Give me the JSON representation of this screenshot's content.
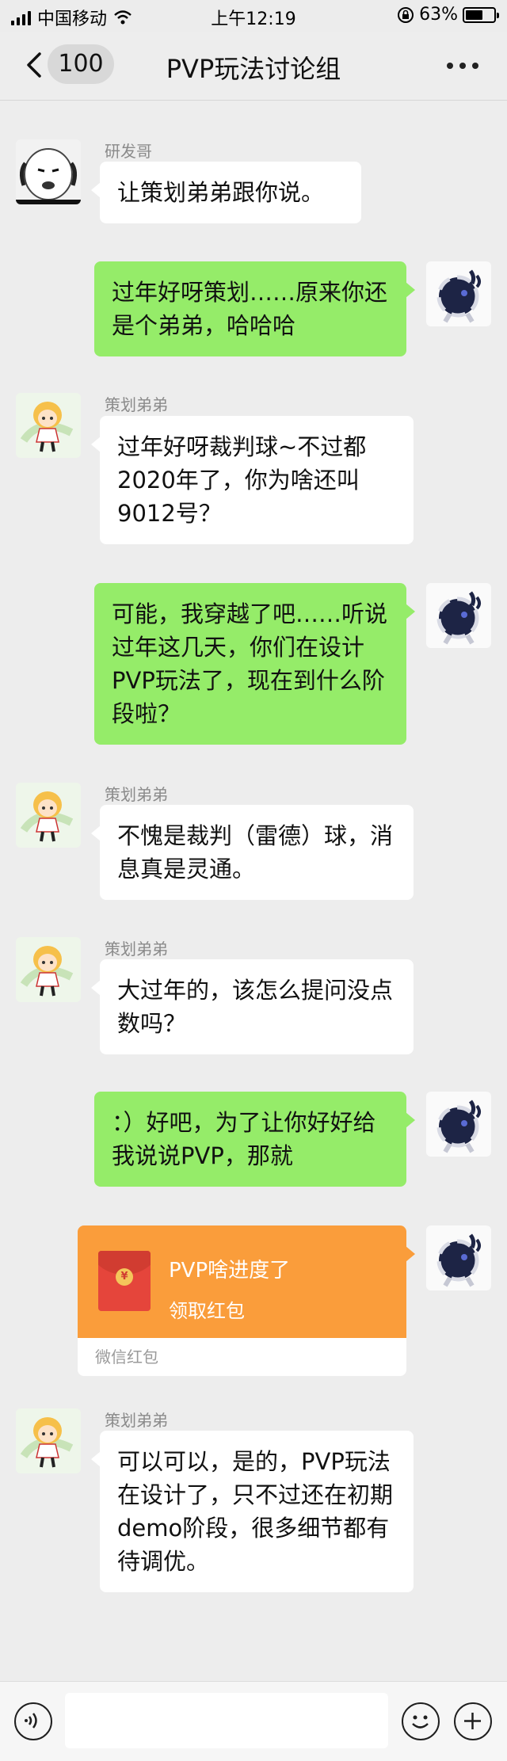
{
  "status_bar": {
    "carrier": "中国移动",
    "time": "上午12:19",
    "battery": "63%",
    "battery_level": 0.63
  },
  "nav": {
    "unread_count": "100",
    "title": "PVP玩法讨论组"
  },
  "messages": [
    {
      "sender": "研发哥",
      "text": "让策划弟弟跟你说。"
    },
    {
      "text": "过年好呀策划……原来你还是个弟弟，哈哈哈"
    },
    {
      "sender": "策划弟弟",
      "text": "过年好呀裁判球~不过都2020年了，你为啥还叫9012号？"
    },
    {
      "text": "可能，我穿越了吧……听说过年这几天，你们在设计PVP玩法了，现在到什么阶段啦？"
    },
    {
      "sender": "策划弟弟",
      "text": "不愧是裁判（雷德）球，消息真是灵通。"
    },
    {
      "sender": "策划弟弟",
      "text": "大过年的，该怎么提问没点数吗？"
    },
    {
      "text": "：）好吧，为了让你好好给我说说PVP，那就"
    },
    {
      "sender": "策划弟弟",
      "text": "可以可以，是的，PVP玩法在设计了，只不过还在初期demo阶段，很多细节都有待调优。"
    }
  ],
  "red_packet": {
    "title": "PVP啥进度了",
    "action": "领取红包",
    "footer": "微信红包",
    "coin_symbol": "¥"
  },
  "colors": {
    "outgoing_bubble": "#95ec69",
    "incoming_bubble": "#ffffff",
    "red_packet": "#fa9d3b",
    "background": "#ededed"
  }
}
